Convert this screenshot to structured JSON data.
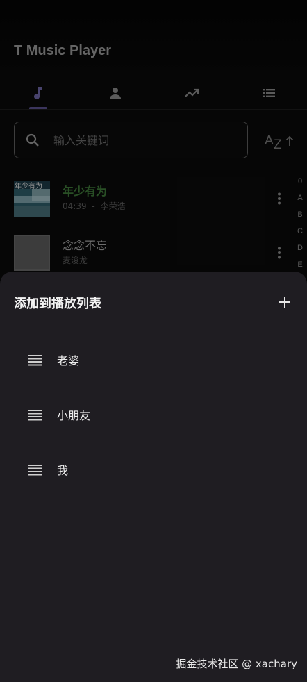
{
  "app": {
    "title": "T Music Player"
  },
  "tabs": [
    {
      "icon": "music-note-icon",
      "active": true
    },
    {
      "icon": "person-icon",
      "active": false
    },
    {
      "icon": "trending-up-icon",
      "active": false
    },
    {
      "icon": "list-icon",
      "active": false
    }
  ],
  "search": {
    "placeholder": "输入关键词",
    "value": ""
  },
  "sort": {
    "label_a": "A",
    "label_z": "Z",
    "icon": "sort-az-icon"
  },
  "songs": [
    {
      "title": "年少有为",
      "duration": "04:39",
      "separator": "-",
      "artist": "李荣浩",
      "playing": true,
      "cover_text": "年少有为"
    },
    {
      "title": "念念不忘",
      "duration": "",
      "separator": "",
      "artist": "麦浚龙",
      "playing": false,
      "cover_text": ""
    }
  ],
  "alpha_index": [
    "0",
    "A",
    "B",
    "C",
    "D",
    "E"
  ],
  "sheet": {
    "title": "添加到播放列表",
    "add_icon": "plus-icon",
    "playlists": [
      {
        "label": "老婆"
      },
      {
        "label": "小朋友"
      },
      {
        "label": "我"
      }
    ]
  },
  "watermark": "掘金技术社区 @ xachary",
  "colors": {
    "accent": "#5b5290",
    "playing_green": "#3f7a3a",
    "sheet_bg": "#1f1d22",
    "icon_gray": "#8c8c8c"
  }
}
